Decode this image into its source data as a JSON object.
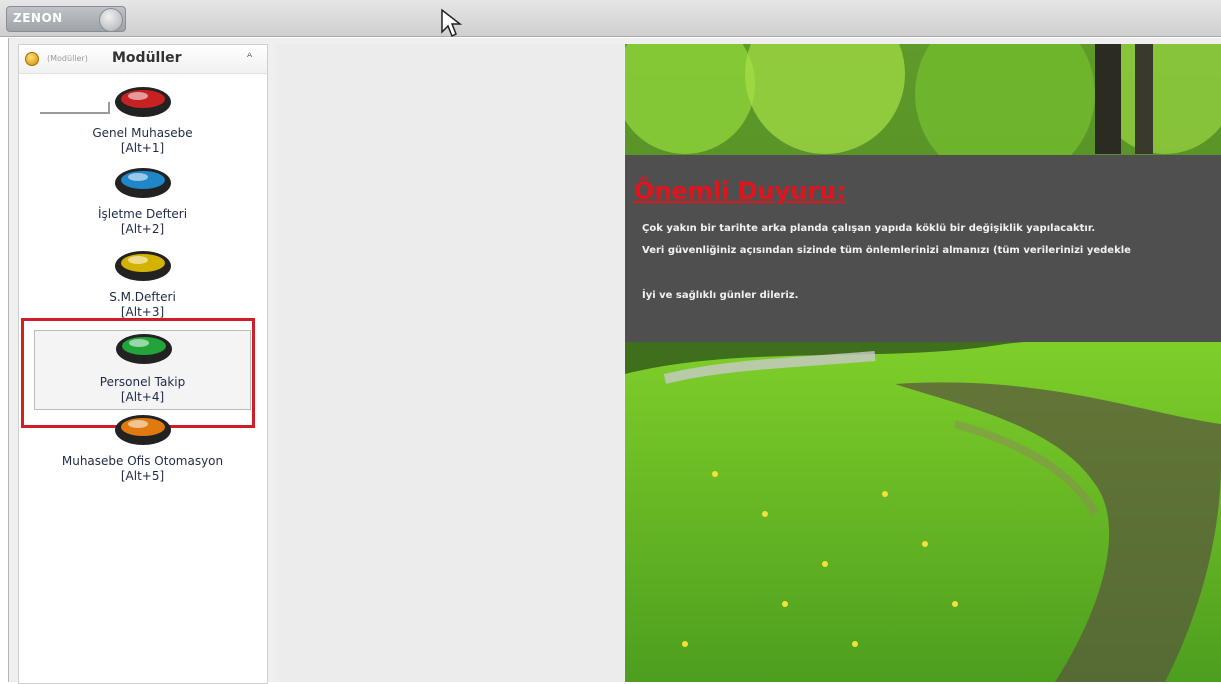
{
  "app": {
    "logo_text": "ZENON"
  },
  "sidebar": {
    "hint": "(Modüller)",
    "title": "Modüller",
    "collapse_glyph": "ᴬ",
    "modules": [
      {
        "name": "Genel Muhasebe",
        "shortcut": "[Alt+1]",
        "color": "#c62222"
      },
      {
        "name": "İşletme Defteri",
        "shortcut": "[Alt+2]",
        "color": "#1f86c8"
      },
      {
        "name": "S.M.Defteri",
        "shortcut": "[Alt+3]",
        "color": "#d4b200"
      },
      {
        "name": "Personel Takip",
        "shortcut": "[Alt+4]",
        "color": "#22a43a"
      },
      {
        "name": "Muhasebe Ofis Otomasyon",
        "shortcut": "[Alt+5]",
        "color": "#e07a10"
      }
    ]
  },
  "notice": {
    "title": "Önemli Duyuru:",
    "line1": "Çok yakın bir tarihte arka planda çalışan yapıda köklü bir değişiklik yapılacaktır.",
    "line2": "Veri güvenliğiniz açısından sizinde tüm önlemlerinizi almanızı (tüm verilerinizi yedekle",
    "line3": "İyi ve sağlıklı günler dileriz."
  },
  "colors": {
    "accent_red": "#d01e28",
    "notice_bg": "#4f4f4f"
  }
}
